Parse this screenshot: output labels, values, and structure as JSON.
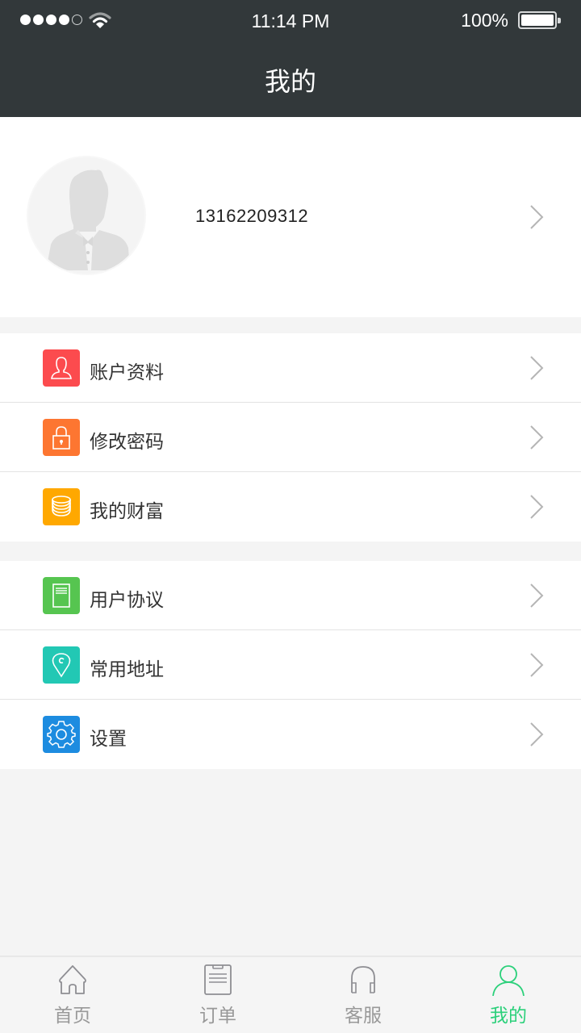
{
  "status_bar": {
    "signal_bars_filled": 4,
    "signal_bars_total": 5,
    "wifi_icon": "wifi-icon",
    "time": "11:14 PM",
    "battery_percent": "100%",
    "battery_level": 1.0
  },
  "header": {
    "title": "我的"
  },
  "profile": {
    "avatar_icon": "default-avatar-icon",
    "phone": "13162209312",
    "chevron_icon": "chevron-right-icon"
  },
  "menu_groups": [
    {
      "items": [
        {
          "label": "账户资料",
          "icon": "user-icon",
          "color": "#fc4b4e"
        },
        {
          "label": "修改密码",
          "icon": "lock-icon",
          "color": "#fd7631"
        },
        {
          "label": "我的财富",
          "icon": "coins-icon",
          "color": "#ffa800"
        }
      ]
    },
    {
      "items": [
        {
          "label": "用户协议",
          "icon": "document-icon",
          "color": "#56c550"
        },
        {
          "label": "常用地址",
          "icon": "location-pin-icon",
          "color": "#22c8b4"
        },
        {
          "label": "设置",
          "icon": "gear-icon",
          "color": "#1d8ce0"
        }
      ]
    }
  ],
  "tabbar": {
    "active_color": "#2bd07a",
    "inactive_color": "#999999",
    "tabs": [
      {
        "label": "首页",
        "icon": "home-icon",
        "active": false
      },
      {
        "label": "订单",
        "icon": "order-icon",
        "active": false
      },
      {
        "label": "客服",
        "icon": "headphones-icon",
        "active": false
      },
      {
        "label": "我的",
        "icon": "person-icon",
        "active": true
      }
    ]
  }
}
